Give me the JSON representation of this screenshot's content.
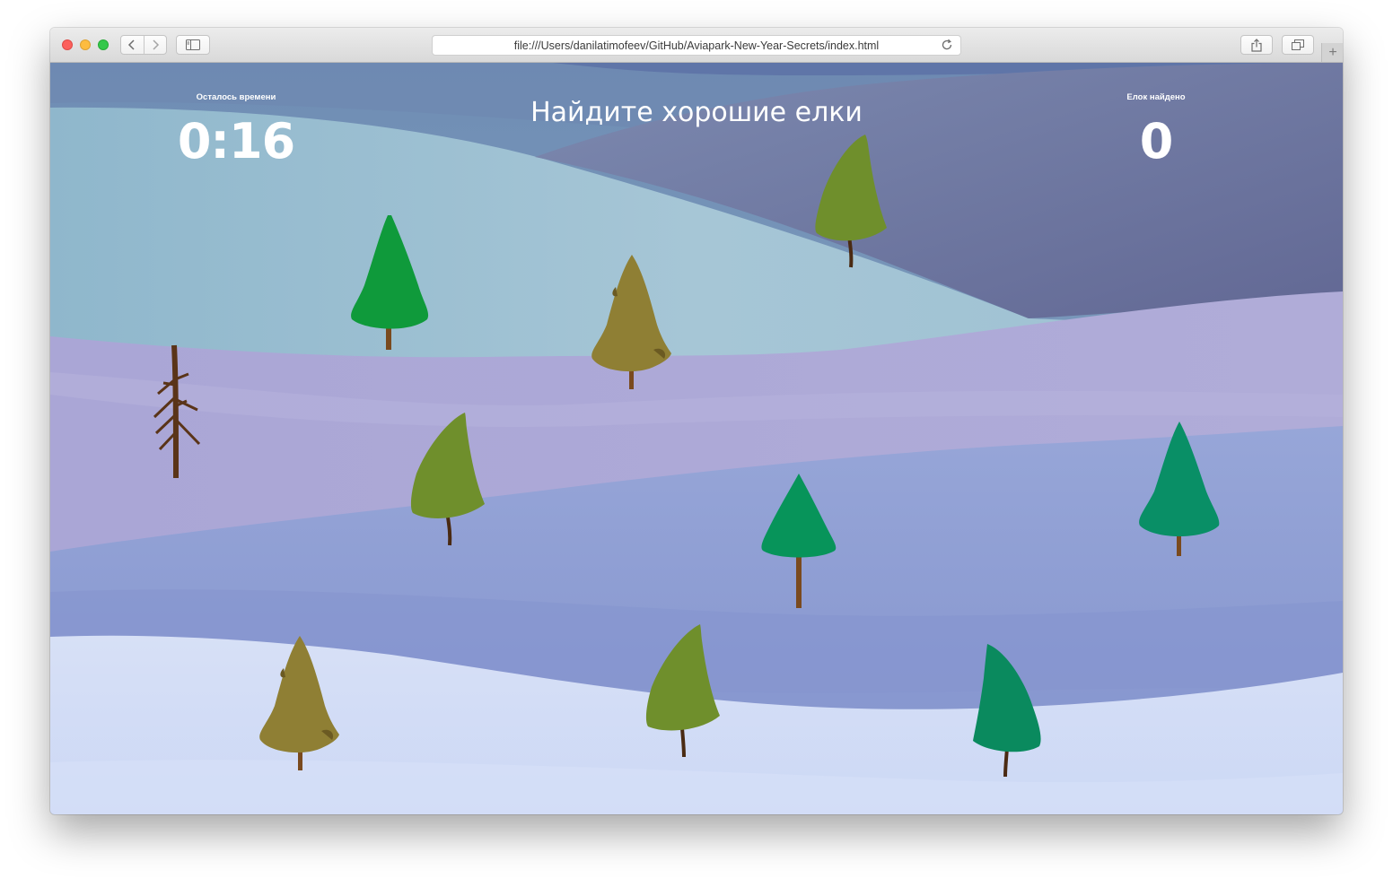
{
  "browser": {
    "url": "file:///Users/danilatimofeev/GitHub/Aviapark-New-Year-Secrets/index.html",
    "icons": {
      "back": "chevron-left-icon",
      "forward": "chevron-right-icon",
      "sidebar": "sidebar-icon",
      "reload": "reload-icon",
      "share": "share-icon",
      "tabs": "tabs-overview-icon",
      "new_tab": "plus-icon"
    }
  },
  "game": {
    "timer_label": "Осталось времени",
    "timer_value": "0:16",
    "title": "Найдите хорошие елки",
    "found_label": "Елок найдено",
    "found_value": "0"
  },
  "trees": [
    {
      "kind": "good-tree",
      "color": "#0f9a3b"
    },
    {
      "kind": "bent-tree",
      "color": "#6f8f2c"
    },
    {
      "kind": "bitten-tree",
      "color": "#8f7f34"
    },
    {
      "kind": "dead-tree",
      "color": "#5a3418"
    },
    {
      "kind": "bent-tree",
      "color": "#6f8f2c"
    },
    {
      "kind": "good-tree",
      "color": "#07945a"
    },
    {
      "kind": "good-tree",
      "color": "#098f66"
    },
    {
      "kind": "bitten-tree",
      "color": "#8f7f34"
    },
    {
      "kind": "bent-tree",
      "color": "#6f8f2c"
    },
    {
      "kind": "bent-tree",
      "color": "#0a8a5e"
    }
  ],
  "colors": {
    "sky_top": "#7c95b9",
    "hill_teal": "#9cc0d2",
    "hill_navy": "#6b719a",
    "hill_lilac": "#ada8d4",
    "hill_blue": "#8d9dd2",
    "hill_snow": "#cfdaf4",
    "hud_text": "#ffffff"
  }
}
